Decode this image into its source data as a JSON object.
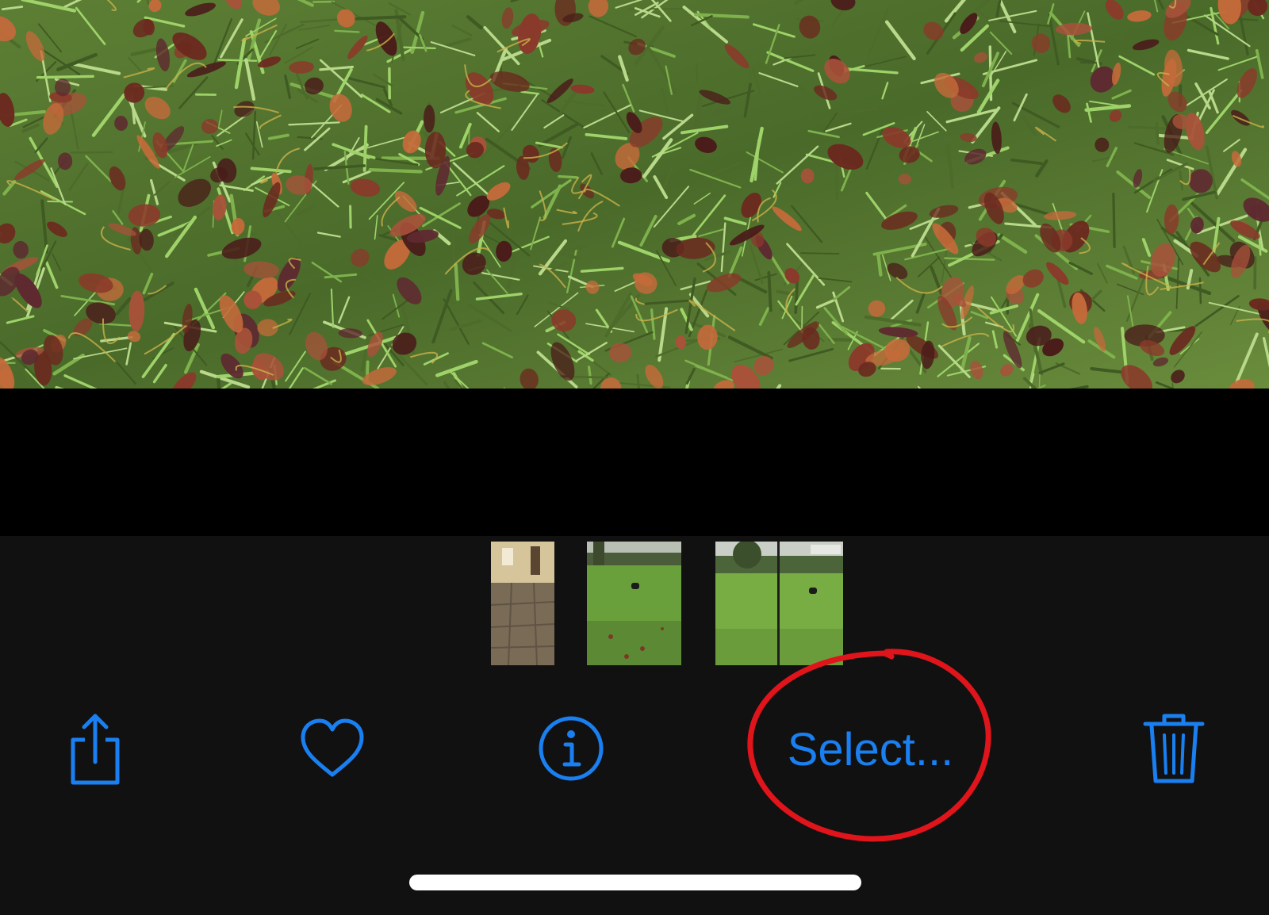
{
  "photo": {
    "icon": "photo-grass-leaves",
    "colors": {
      "grass_dark": "#4d6b2a",
      "grass_light": "#9fd36a",
      "leaf_brown": "#6b2a1f",
      "leaf_orange": "#c46a3a"
    }
  },
  "filmstrip": {
    "items": [
      {
        "icon": "thumb-hallway"
      },
      {
        "icon": "thumb-lawn-cat"
      },
      {
        "icon": "thumb-lawn-split"
      }
    ]
  },
  "toolbar": {
    "accent_color": "#1a7ff0",
    "share_icon": "share-icon",
    "favorite_icon": "heart-icon",
    "info_icon": "info-icon",
    "select_label": "Select...",
    "delete_icon": "trash-icon"
  },
  "annotation": {
    "color": "#e0141b",
    "shape": "ellipse"
  }
}
